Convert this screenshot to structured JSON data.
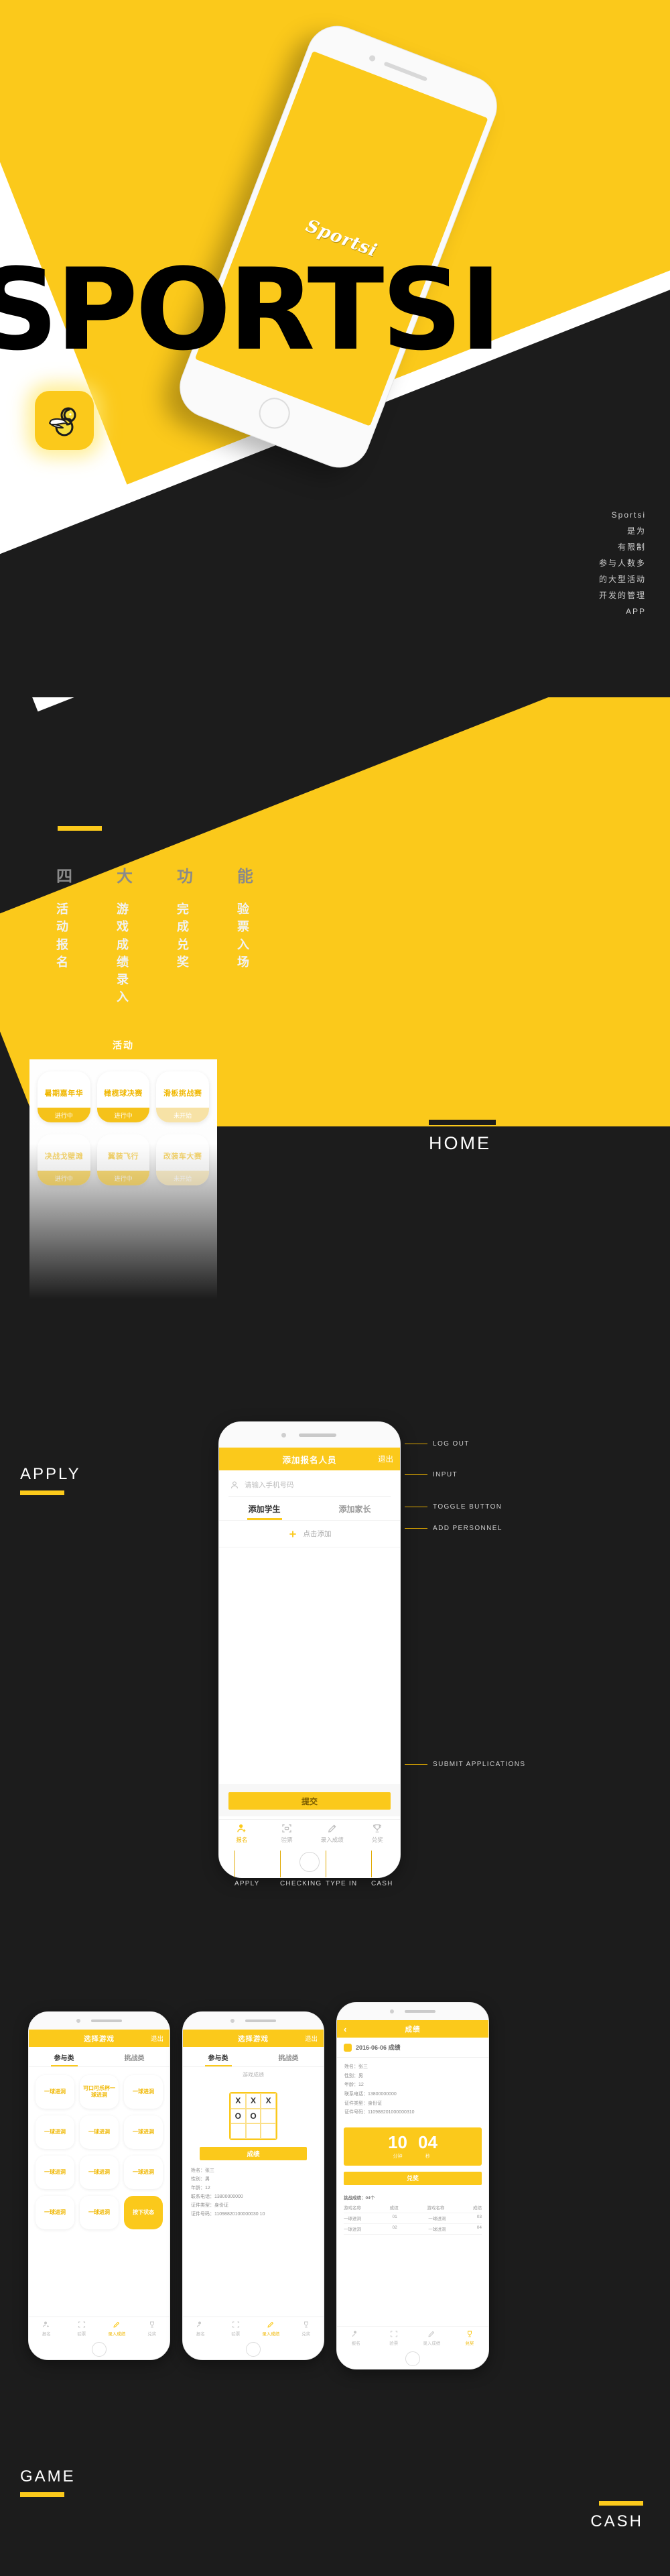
{
  "hero": {
    "headline": "SPORTSI",
    "app_icon_name": "sportsi-logo",
    "phone_logo": "Sportsi",
    "description_lines": [
      "Sportsi",
      "是为",
      "有限制",
      "参与人数多",
      "的大型活动",
      "开发的管理",
      "APP"
    ]
  },
  "features": {
    "headings": [
      "四",
      "大",
      "功",
      "能"
    ],
    "items": [
      "活动报名",
      "游戏成绩录入",
      "完成兑奖",
      "验票入场"
    ]
  },
  "home": {
    "section_label": "HOME",
    "screen": {
      "title": "活动",
      "cards_row1": [
        {
          "name": "暑期嘉年华",
          "status": "进行中"
        },
        {
          "name": "橄榄球决赛",
          "status": "进行中"
        },
        {
          "name": "滑板挑战赛",
          "status": "未开始"
        }
      ],
      "cards_row2": [
        {
          "name": "决战戈壁滩",
          "status": "进行中"
        },
        {
          "name": "翼装飞行",
          "status": "进行中"
        },
        {
          "name": "改装车大赛",
          "status": "未开始"
        }
      ]
    }
  },
  "apply": {
    "section_label": "APPLY",
    "screen": {
      "nav_title": "添加报名人员",
      "nav_action": "退出",
      "input_placeholder": "请输入手机号码",
      "toggle": [
        "添加学生",
        "添加家长"
      ],
      "add_label": "点击添加",
      "add_icon": "plus-icon",
      "submit_label": "提交",
      "tabs": [
        {
          "label": "报名",
          "icon": "add-user-icon"
        },
        {
          "label": "验票",
          "icon": "scan-icon"
        },
        {
          "label": "录入成绩",
          "icon": "pencil-icon"
        },
        {
          "label": "兑奖",
          "icon": "trophy-icon"
        }
      ]
    },
    "annotations": [
      "LOG OUT",
      "INPUT",
      "TOGGLE BUTTON",
      "ADD PERSONNEL",
      "SUBMIT APPLICATIONS"
    ],
    "tab_annotations": [
      "APPLY",
      "CHECKING",
      "TYPE IN",
      "CASH"
    ]
  },
  "game": {
    "section_label": "GAME",
    "cash_label": "CASH",
    "phone1": {
      "nav_title": "选择游戏",
      "nav_action": "退出",
      "tabs": [
        "参与类",
        "挑战类"
      ],
      "cells": [
        "一球进洞",
        "可口可乐杯一球进洞",
        "一球进洞",
        "一球进洞",
        "一球进洞",
        "一球进洞",
        "一球进洞",
        "一球进洞",
        "一球进洞",
        "一球进洞",
        "一球进洞",
        "按下状态"
      ],
      "tabbar": [
        "报名",
        "验票",
        "录入成绩",
        "兑奖"
      ]
    },
    "phone2": {
      "nav_title": "选择游戏",
      "nav_action": "退出",
      "tabs": [
        "参与类",
        "挑战类"
      ],
      "section_label": "游戏成绩",
      "grid_marks": [
        "X",
        "X",
        "X",
        "O",
        "O",
        "",
        "",
        "",
        ""
      ],
      "submit_label": "成绩",
      "info": [
        "姓名：张三",
        "性别：男",
        "年龄：12",
        "联系电话：13800000000",
        "证件类型：身份证",
        "证件号码：11098820100000030 10"
      ],
      "tabbar": [
        "报名",
        "验票",
        "录入成绩",
        "兑奖"
      ]
    },
    "phone3": {
      "nav_title": "成绩",
      "back_icon": "chevron-left-icon",
      "record_title": "2016-06-06 成绩",
      "info": [
        "姓名：张三",
        "性别：男",
        "年龄：12",
        "联系电话：13800000000",
        "证件类型：身份证",
        "证件号码：110988201000000310"
      ],
      "score": [
        {
          "value": "10",
          "unit": "分钟"
        },
        {
          "value": "04",
          "unit": "秒"
        }
      ],
      "action_label": "兑奖",
      "table_title": "挑战成绩：04个",
      "table_headers": [
        "游戏名称",
        "成绩",
        "游戏名称",
        "成绩"
      ],
      "table_rows": [
        [
          "一球进洞",
          "01",
          "一球进洞",
          "03"
        ],
        [
          "一球进洞",
          "02",
          "一球进洞",
          "04"
        ]
      ],
      "tabbar": [
        "报名",
        "验票",
        "录入成绩",
        "兑奖"
      ]
    }
  },
  "colors": {
    "brand_yellow": "#fbc91b",
    "dark": "#1c1c1c",
    "white": "#ffffff"
  }
}
